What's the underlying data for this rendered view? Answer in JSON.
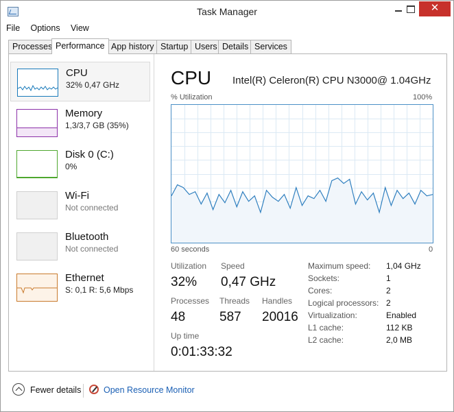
{
  "window": {
    "title": "Task Manager",
    "close_glyph": "✕"
  },
  "menu": [
    "File",
    "Options",
    "View"
  ],
  "tabs": [
    "Processes",
    "Performance",
    "App history",
    "Startup",
    "Users",
    "Details",
    "Services"
  ],
  "active_tab": "Performance",
  "resources": [
    {
      "name": "CPU",
      "detail": "32%  0,47 GHz",
      "color": "#1779ba",
      "selected": true
    },
    {
      "name": "Memory",
      "detail": "1,3/3,7 GB (35%)",
      "color": "#8b2fa8"
    },
    {
      "name": "Disk 0 (C:)",
      "detail": "0%",
      "color": "#4ea72e"
    },
    {
      "name": "Wi-Fi",
      "detail": "Not connected",
      "color": "#cfcfcf"
    },
    {
      "name": "Bluetooth",
      "detail": "Not connected",
      "color": "#cfcfcf"
    },
    {
      "name": "Ethernet",
      "detail": "S: 0,1  R: 5,6 Mbps",
      "color": "#c97a2c"
    }
  ],
  "detail": {
    "title": "CPU",
    "model": "Intel(R) Celeron(R) CPU N3000@ 1.04GHz",
    "graph_label": "% Utilization",
    "graph_max": "100%",
    "time_span": "60 seconds",
    "time_zero": "0",
    "stats": {
      "utilization_label": "Utilization",
      "utilization_value": "32%",
      "speed_label": "Speed",
      "speed_value": "0,47 GHz",
      "processes_label": "Processes",
      "processes_value": "48",
      "threads_label": "Threads",
      "threads_value": "587",
      "handles_label": "Handles",
      "handles_value": "20016",
      "uptime_label": "Up time",
      "uptime_value": "0:01:33:32"
    },
    "specs": [
      {
        "label": "Maximum speed:",
        "value": "1,04 GHz"
      },
      {
        "label": "Sockets:",
        "value": "1"
      },
      {
        "label": "Cores:",
        "value": "2"
      },
      {
        "label": "Logical processors:",
        "value": "2"
      },
      {
        "label": "Virtualization:",
        "value": "Enabled"
      },
      {
        "label": "L1 cache:",
        "value": "112 KB"
      },
      {
        "label": "L2 cache:",
        "value": "2,0 MB"
      }
    ]
  },
  "cpu_history_percent": [
    34,
    42,
    40,
    35,
    37,
    28,
    36,
    24,
    35,
    29,
    38,
    26,
    37,
    30,
    34,
    22,
    38,
    33,
    30,
    35,
    25,
    40,
    27,
    34,
    32,
    38,
    30,
    45,
    47,
    43,
    46,
    28,
    37,
    31,
    36,
    22,
    40,
    27,
    38,
    32,
    36,
    28,
    38,
    34,
    35
  ],
  "footer": {
    "fewer_details": "Fewer details",
    "resource_monitor": "Open Resource Monitor"
  }
}
